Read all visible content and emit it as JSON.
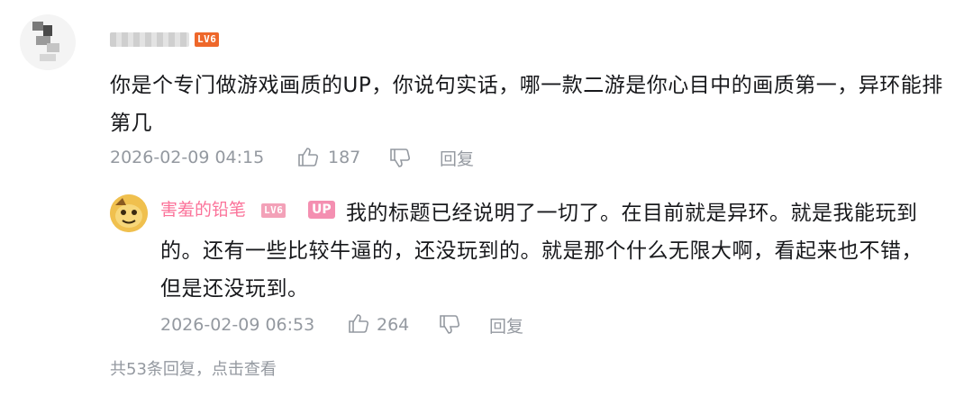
{
  "comment": {
    "level_badge": "LV6",
    "text": "你是个专门做游戏画质的UP，你说句实话，哪一款二游是你心目中的画质第一，异环能排第几",
    "date": "2026-02-09 04:15",
    "likes": "187",
    "reply_label": "回复"
  },
  "reply": {
    "username": "害羞的铅笔",
    "level_badge": "LV6",
    "up_badge": "UP",
    "text": "我的标题已经说明了一切了。在目前就是异环。就是我能玩到的。还有一些比较牛逼的，还没玩到的。就是那个什么无限大啊，看起来也不错，但是还没玩到。",
    "date": "2026-02-09 06:53",
    "likes": "264",
    "reply_label": "回复"
  },
  "footer": {
    "more_replies": "共53条回复，点击查看"
  },
  "colors": {
    "username_pink": "#fb7299",
    "meta_gray": "#9499a0",
    "level_orange": "#ee672a"
  }
}
